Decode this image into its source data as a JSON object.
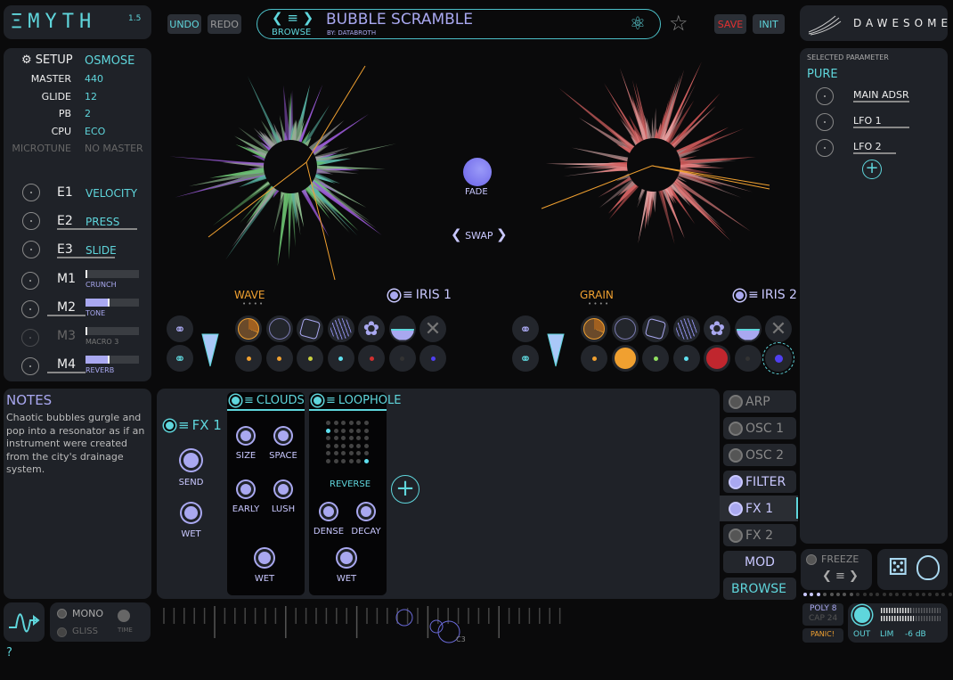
{
  "app": {
    "logo": "ΞMYTH",
    "version": "1.5"
  },
  "toolbar": {
    "undo": "UNDO",
    "redo": "REDO",
    "save": "SAVE",
    "init": "INIT"
  },
  "preset": {
    "name": "BUBBLE SCRAMBLE",
    "author": "BY: DATABROTH",
    "browse": "BROWSE"
  },
  "brand": {
    "name": "DAWESOME"
  },
  "setup": {
    "title": "SETUP",
    "rows": [
      {
        "label": "MASTER",
        "value": "440"
      },
      {
        "label": "GLIDE",
        "value": "12"
      },
      {
        "label": "PB",
        "value": "2"
      },
      {
        "label": "CPU",
        "value": "ECO"
      },
      {
        "label": "MICROTUNE",
        "value": "NO MASTER"
      }
    ],
    "preset_value": "OSMOSE"
  },
  "expressions": [
    {
      "id": "E1",
      "target": "VELOCITY"
    },
    {
      "id": "E2",
      "target": "PRESS"
    },
    {
      "id": "E3",
      "target": "SLIDE"
    }
  ],
  "macros": [
    {
      "id": "M1",
      "name": "CRUNCH",
      "level": 0.02
    },
    {
      "id": "M2",
      "name": "TONE",
      "level": 0.45
    },
    {
      "id": "M3",
      "name": "MACRO 3",
      "level": 0.02
    },
    {
      "id": "M4",
      "name": "REVERB",
      "level": 0.45
    }
  ],
  "notes": {
    "title": "NOTES",
    "text": "Chaotic bubbles gurgle and pop into a resonator as if an instrument were created from the city's drainage system."
  },
  "center": {
    "fade": "FADE",
    "swap": "SWAP"
  },
  "iris1": {
    "mode": "WAVE",
    "title": "IRIS 1",
    "dot_colors": [
      "#f0a030",
      "#f0a030",
      "#c8d040",
      "#5fe0f0",
      "#d03030",
      "#333",
      "#5040f0"
    ]
  },
  "iris2": {
    "mode": "GRAIN",
    "title": "IRIS 2",
    "dot_colors": [
      "#f0a030",
      "#f0a030",
      "#90e060",
      "#5fe0f0",
      "#c0262e",
      "#333",
      "#5040f0"
    ]
  },
  "selected_parameter": {
    "header": "SELECTED PARAMETER",
    "name": "PURE",
    "mods": [
      "MAIN ADSR",
      "LFO 1",
      "LFO 2"
    ]
  },
  "fx": {
    "title": "FX 1",
    "knobs": [
      "SEND",
      "WET"
    ],
    "clouds": {
      "title": "CLOUDS",
      "knobs": [
        "SIZE",
        "SPACE",
        "EARLY",
        "LUSH",
        "WET"
      ]
    },
    "loophole": {
      "title": "LOOPHOLE",
      "mode": "REVERSE",
      "knobs": [
        "DENSE",
        "DECAY",
        "WET"
      ]
    }
  },
  "tabs": [
    {
      "label": "ARP",
      "on": false
    },
    {
      "label": "OSC 1",
      "on": false
    },
    {
      "label": "OSC 2",
      "on": false
    },
    {
      "label": "FILTER",
      "on": true
    },
    {
      "label": "FX 1",
      "on": true,
      "selected": true
    },
    {
      "label": "FX 2",
      "on": false
    }
  ],
  "mod_label": "MOD",
  "browse_label": "BROWSE",
  "freeze": "FREEZE",
  "voice": {
    "mono": "MONO",
    "gliss": "GLISS",
    "time": "TIME"
  },
  "keyboard": {
    "note": "C3"
  },
  "poly": {
    "poly": "POLY 8",
    "cap": "CAP 24",
    "panic": "PANIC!"
  },
  "output": {
    "out": "OUT",
    "lim": "LIM",
    "gain": "-6 dB"
  },
  "help": "?",
  "colors": {
    "accent": "#5fd6dc",
    "lavender": "#a9a8f0",
    "orange": "#f0a030",
    "save": "#e03030"
  }
}
